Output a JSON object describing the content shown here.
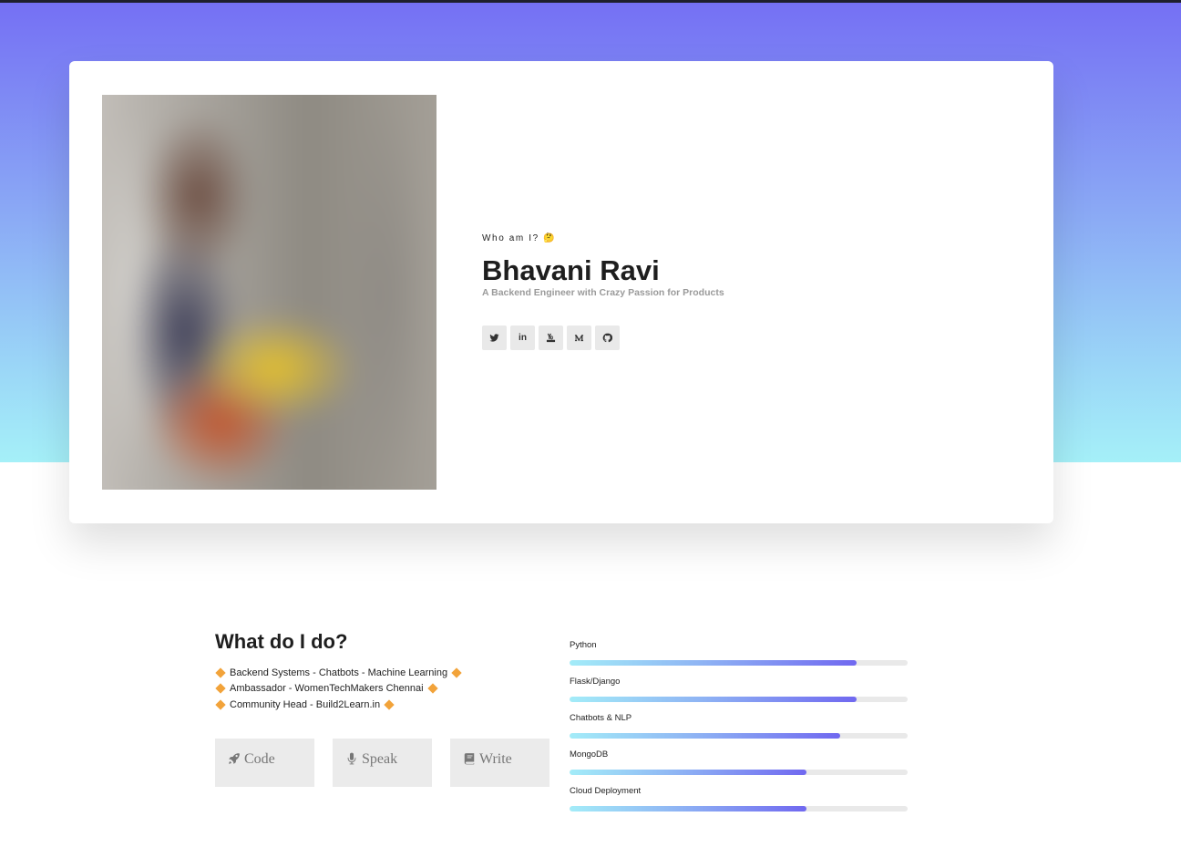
{
  "hero": {
    "who_label": "Who am I? 🤔",
    "name": "Bhavani Ravi",
    "tagline": "A Backend Engineer with Crazy Passion for Products",
    "photo_alt": "profile-photo",
    "socials": [
      {
        "icon": "twitter-icon"
      },
      {
        "icon": "linkedin-icon",
        "glyph": "in"
      },
      {
        "icon": "youtube-icon"
      },
      {
        "icon": "medium-icon"
      },
      {
        "icon": "github-icon"
      }
    ]
  },
  "about": {
    "heading": "What do I do?",
    "items": [
      "Backend Systems - Chatbots - Machine Learning",
      "Ambassador - WomenTechMakers Chennai",
      "Community Head - Build2Learn.in"
    ],
    "actions": [
      {
        "label": "Code",
        "icon": "rocket-icon"
      },
      {
        "label": "Speak",
        "icon": "microphone-icon"
      },
      {
        "label": "Write",
        "icon": "book-icon"
      }
    ]
  },
  "skills": [
    {
      "name": "Python",
      "level": 0.85
    },
    {
      "name": "Flask/Django",
      "level": 0.85
    },
    {
      "name": "Chatbots & NLP",
      "level": 0.8
    },
    {
      "name": "MongoDB",
      "level": 0.7
    },
    {
      "name": "Cloud Deployment",
      "level": 0.7
    }
  ],
  "colors": {
    "gradient_top": "#7570f4",
    "gradient_bottom": "#a5f0f8",
    "bar_start": "#a3ecf8",
    "bar_end": "#7068f0",
    "diamond": "#f2a33a"
  }
}
